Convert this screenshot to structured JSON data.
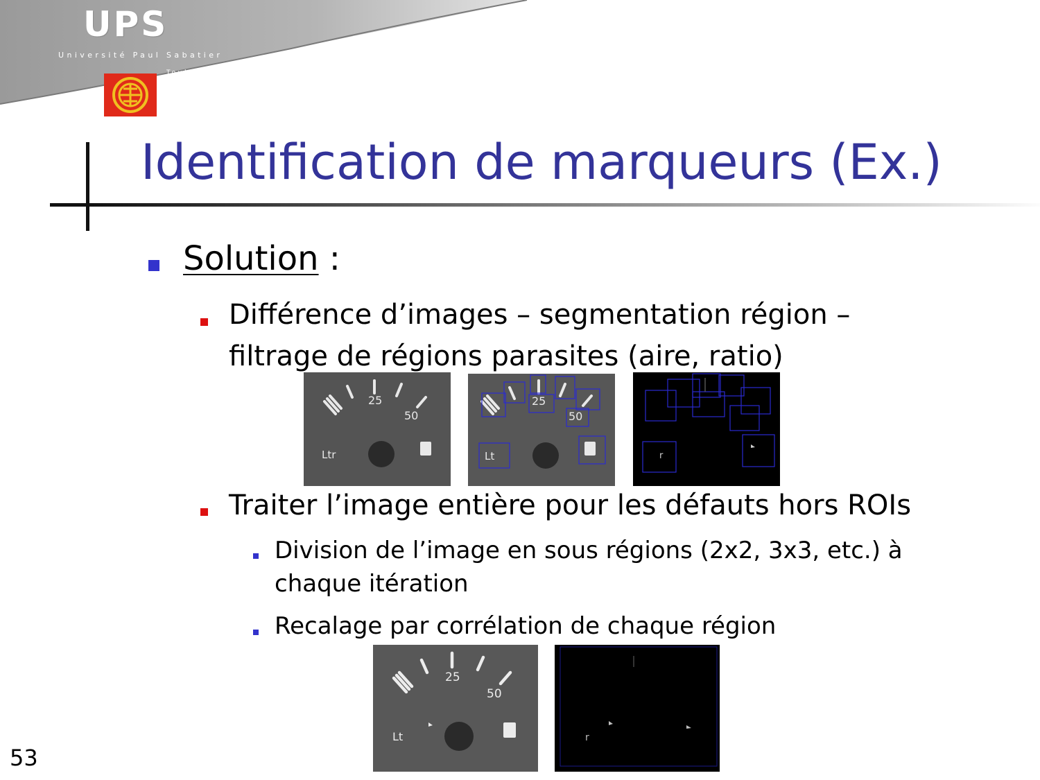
{
  "logo": {
    "name": "UPS",
    "university": "Université Paul Sabatier",
    "city": "Toulouse 3"
  },
  "slide": {
    "title": "Identification de marqueurs (Ex.)",
    "page_number": "53",
    "solution_label": "Solution",
    "solution_colon": " :",
    "bullets": {
      "b1_line1": "Différence d’images – segmentation région –",
      "b1_line2": "filtrage de régions parasites (aire, ratio)",
      "b2": "Traiter l’image entière pour les défauts hors ROIs",
      "sub1_line1": "Division de l’image en sous régions (2x2, 3x3, etc.) à",
      "sub1_line2": "chaque itération",
      "sub2": "Recalage par corrélation de chaque région"
    }
  },
  "gauge_labels": {
    "mid": "25",
    "high": "50",
    "ltr": "Ltr",
    "lt": "Lt",
    "r": "r"
  },
  "colors": {
    "title": "#333399",
    "bullet_level1": "#3333cc",
    "bullet_level2": "#dd1111",
    "roi_box": "#2a2ad0"
  }
}
